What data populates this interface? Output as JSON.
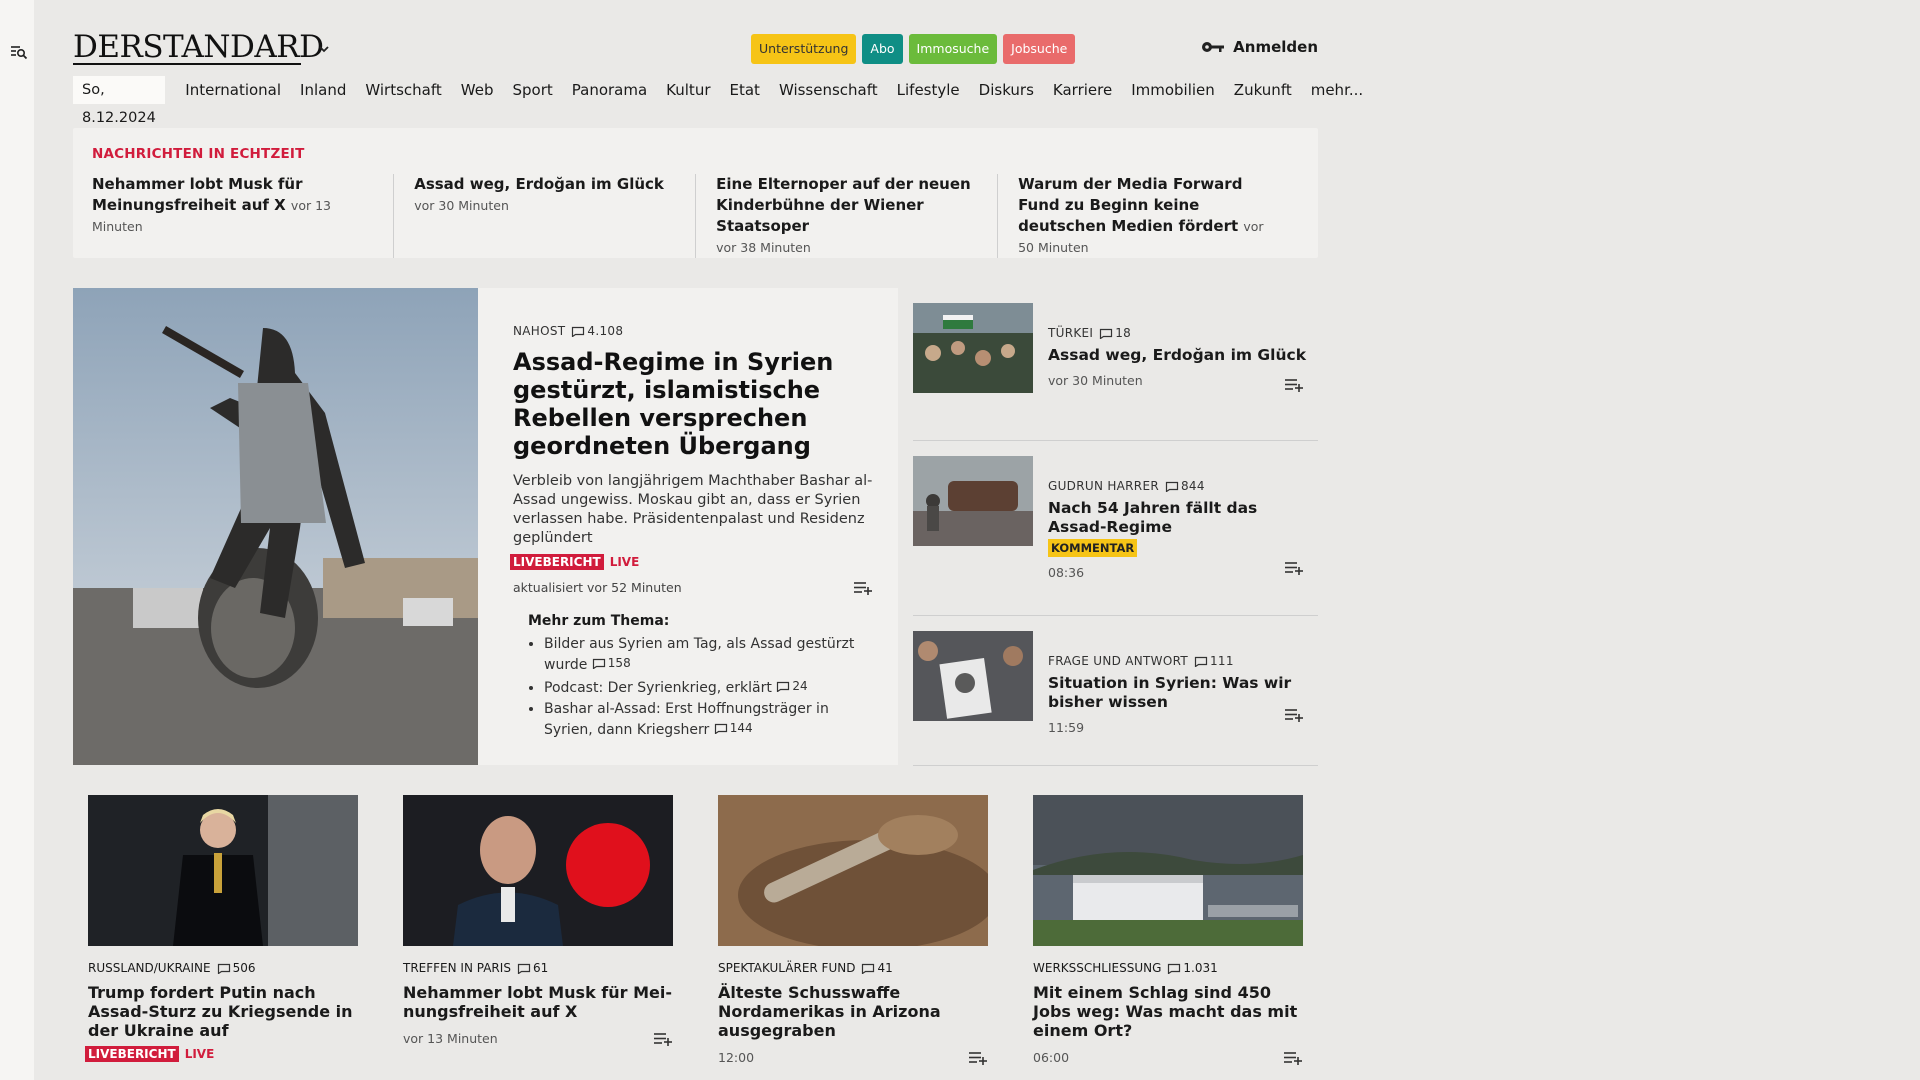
{
  "header": {
    "logo": "DERSTANDARD",
    "pills": {
      "support": "Unterstützung",
      "abo": "Abo",
      "immo": "Immosuche",
      "job": "Jobsuche"
    },
    "login": "Anmelden"
  },
  "nav": {
    "date": "So, 8.12.2024",
    "items": [
      "International",
      "Inland",
      "Wirtschaft",
      "Web",
      "Sport",
      "Panorama",
      "Kultur",
      "Etat",
      "Wissenschaft",
      "Lifestyle",
      "Diskurs",
      "Karriere",
      "Immobilien",
      "Zukunft",
      "mehr..."
    ]
  },
  "ticker": {
    "title": "NACHRICHTEN IN ECHTZEIT",
    "items": [
      {
        "title": "Nehammer lobt Musk für Meinungs­freiheit auf X",
        "time": "vor 13 Minuten"
      },
      {
        "title": "Assad weg, Erdoğan im Glück",
        "time": "vor 30 Minuten"
      },
      {
        "title": "Eine Elternoper auf der neuen Kinder­bühne der Wiener Staatsoper",
        "time": "vor 38 Minuten"
      },
      {
        "title": "Warum der Media Forward Fund zu Beginn keine deutschen Medien för­dert",
        "time": "vor 50 Minuten"
      }
    ]
  },
  "lead": {
    "kicker": "NAHOST",
    "comments": "4.108",
    "title": "Assad-Regime in Syrien gestürzt, islamistische Rebellen versprechen geordneten Übergang",
    "teaser": "Verbleib von langjährigem Machthaber Bashar al-Assad ungewiss. Moskau gibt an, dass er Syrien verlassen habe. Präsidentenpalast und Residenz geplündert",
    "badge": "LIVEBERICHT",
    "live": "LIVE",
    "updated": "aktualisiert vor 52 Minuten",
    "more_title": "Mehr zum Thema:",
    "more": [
      {
        "text": "Bilder aus Syrien am Tag, als Assad gestürzt wurde",
        "comments": "158"
      },
      {
        "text": "Podcast: Der Syrienkrieg, erklärt",
        "comments": "24"
      },
      {
        "text": "Bashar al-Assad: Erst Hoffnungsträger in Syrien, dann Kriegsherr",
        "comments": "144"
      }
    ]
  },
  "side": [
    {
      "kicker": "TÜRKEI",
      "comments": "18",
      "title": "Assad weg, Erdoğan im Glück",
      "time": "vor 30 Minuten"
    },
    {
      "kicker": "GUDRUN HARRER",
      "comments": "844",
      "title": "Nach 54 Jahren fällt das Assad-Regime",
      "badge": "KOMMENTAR",
      "time": "08:36"
    },
    {
      "kicker": "FRAGE UND ANTWORT",
      "comments": "111",
      "title": "Situation in Syrien: Was wir bisher wissen",
      "time": "11:59"
    }
  ],
  "cards": [
    {
      "kicker": "RUSSLAND/UKRAINE",
      "comments": "506",
      "title": "Trump fordert Putin nach Assad-Sturz zu Kriegsende in der Ukraine auf",
      "badge": "LIVEBERICHT",
      "live": "LIVE"
    },
    {
      "kicker": "TREFFEN IN PARIS",
      "comments": "61",
      "title": "Nehammer lobt Musk für Mei­nungsfreiheit auf X",
      "time": "vor 13 Minuten"
    },
    {
      "kicker": "SPEKTAKULÄRER FUND",
      "comments": "41",
      "title": "Älteste Schusswaffe Nordamerikas in Arizona ausgegraben",
      "time": "12:00"
    },
    {
      "kicker": "WERKSSCHLIESSUNG",
      "comments": "1.031",
      "title": "Mit einem Schlag sind 450 Jobs weg: Was macht das mit einem Ort?",
      "time": "06:00"
    }
  ],
  "icons": {
    "search": "search-list-icon",
    "chevron": "chevron-down-icon",
    "key": "key-icon",
    "comment": "comment-icon",
    "add": "add-to-list-icon"
  },
  "colors": {
    "live_red": "#d11c3c",
    "support": "#f6c416",
    "abo": "#0f8e85",
    "immo": "#6bbb3b",
    "job": "#e96b6b"
  }
}
